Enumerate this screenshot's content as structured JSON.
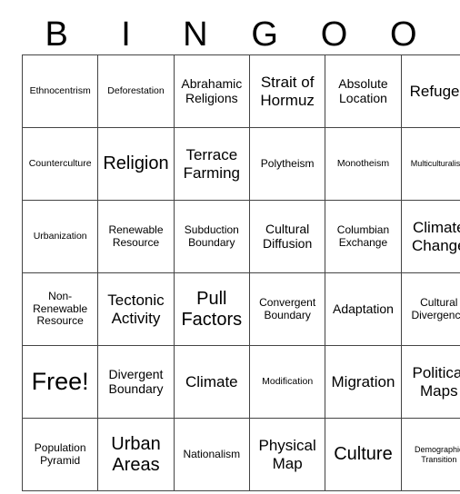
{
  "card": {
    "header_letters": [
      "B",
      "I",
      "N",
      "G",
      "O",
      "O"
    ],
    "free_space_label": "Free!",
    "rows": [
      [
        {
          "text": "Ethnocentrism",
          "size": "fs-xs"
        },
        {
          "text": "Deforestation",
          "size": "fs-xs"
        },
        {
          "text": "Abrahamic Religions",
          "size": "fs-m"
        },
        {
          "text": "Strait of Hormuz",
          "size": "fs-l"
        },
        {
          "text": "Absolute Location",
          "size": "fs-m"
        },
        {
          "text": "Refugee",
          "size": "fs-l"
        }
      ],
      [
        {
          "text": "Counterculture",
          "size": "fs-xs"
        },
        {
          "text": "Religion",
          "size": "fs-xl"
        },
        {
          "text": "Terrace Farming",
          "size": "fs-l"
        },
        {
          "text": "Polytheism",
          "size": "fs-s"
        },
        {
          "text": "Monotheism",
          "size": "fs-xs"
        },
        {
          "text": "Multiculturalism",
          "size": "fs-xxs"
        }
      ],
      [
        {
          "text": "Urbanization",
          "size": "fs-xs"
        },
        {
          "text": "Renewable Resource",
          "size": "fs-s"
        },
        {
          "text": "Subduction Boundary",
          "size": "fs-s"
        },
        {
          "text": "Cultural Diffusion",
          "size": "fs-m"
        },
        {
          "text": "Columbian Exchange",
          "size": "fs-s"
        },
        {
          "text": "Climate Change",
          "size": "fs-l"
        }
      ],
      [
        {
          "text": "Non-Renewable Resource",
          "size": "fs-s"
        },
        {
          "text": "Tectonic Activity",
          "size": "fs-l"
        },
        {
          "text": "Pull Factors",
          "size": "fs-xl"
        },
        {
          "text": "Convergent Boundary",
          "size": "fs-s"
        },
        {
          "text": "Adaptation",
          "size": "fs-m"
        },
        {
          "text": "Cultural Divergence",
          "size": "fs-s"
        }
      ],
      [
        {
          "text": "Free!",
          "size": "fs-xxl"
        },
        {
          "text": "Divergent Boundary",
          "size": "fs-m"
        },
        {
          "text": "Climate",
          "size": "fs-l"
        },
        {
          "text": "Modification",
          "size": "fs-xs"
        },
        {
          "text": "Migration",
          "size": "fs-l"
        },
        {
          "text": "Political Maps",
          "size": "fs-l"
        }
      ],
      [
        {
          "text": "Population Pyramid",
          "size": "fs-s"
        },
        {
          "text": "Urban Areas",
          "size": "fs-xl"
        },
        {
          "text": "Nationalism",
          "size": "fs-s"
        },
        {
          "text": "Physical Map",
          "size": "fs-l"
        },
        {
          "text": "Culture",
          "size": "fs-xl"
        },
        {
          "text": "Demographic Transition",
          "size": "fs-xxs"
        }
      ]
    ]
  },
  "colors": {
    "grid_line": "#444444",
    "text": "#000000",
    "background": "#ffffff"
  }
}
